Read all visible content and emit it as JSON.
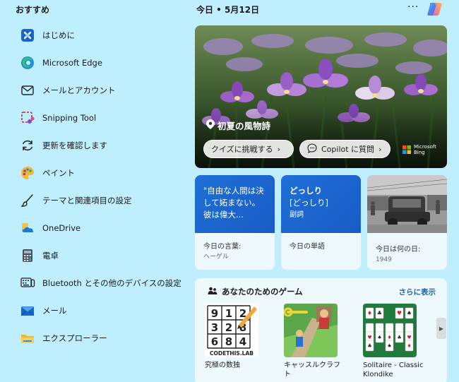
{
  "left": {
    "header": "おすすめ",
    "items": [
      {
        "label": "はじめに",
        "icon": "get-started-icon"
      },
      {
        "label": "Microsoft Edge",
        "icon": "edge-icon"
      },
      {
        "label": "メールとアカウント",
        "icon": "mail-outline-icon"
      },
      {
        "label": "Snipping Tool",
        "icon": "snipping-tool-icon"
      },
      {
        "label": "更新を確認します",
        "icon": "refresh-icon"
      },
      {
        "label": "ペイント",
        "icon": "paint-icon"
      },
      {
        "label": "テーマと関連項目の設定",
        "icon": "brush-icon"
      },
      {
        "label": "OneDrive",
        "icon": "onedrive-icon"
      },
      {
        "label": "電卓",
        "icon": "calculator-icon"
      },
      {
        "label": "Bluetooth とその他のデバイスの設定",
        "icon": "bluetooth-devices-icon"
      },
      {
        "label": "メール",
        "icon": "mail-app-icon"
      },
      {
        "label": "エクスプローラー",
        "icon": "file-explorer-icon"
      }
    ]
  },
  "topbar": {
    "today": "今日 • 5月12日",
    "more": "···"
  },
  "hero": {
    "title": "初夏の風物詩",
    "quiz_button": "クイズに挑戦する",
    "copilot_button": "Copilot に質問",
    "bing_line1": "Microsoft",
    "bing_line2": "Bing"
  },
  "cards": {
    "quote": {
      "text": "\"自由な人間は決して妬まない。彼は偉大...",
      "label": "今日の言葉:",
      "sub": "ヘーゲル"
    },
    "word": {
      "text": "どっしり",
      "reading": "[どっしり]",
      "pos": "副詞",
      "label": "今日の単語"
    },
    "history": {
      "label": "今日は何の日:",
      "sub": "1949"
    }
  },
  "games": {
    "header": "あなたのためのゲーム",
    "see_more": "さらに表示",
    "items": [
      {
        "name": "究極の数独",
        "tile_text": "CODETHIS.LAB",
        "sudoku": [
          "9",
          "1",
          "2",
          "3",
          "2",
          "8",
          "6",
          "8",
          "4"
        ]
      },
      {
        "name": "キャッスルクラフト"
      },
      {
        "name": "Solitaire - Classic Klondike"
      }
    ]
  },
  "colors": {
    "background": "#bfeefe",
    "accent": "#1a5fb4",
    "card_blue": "#1e70d8"
  }
}
